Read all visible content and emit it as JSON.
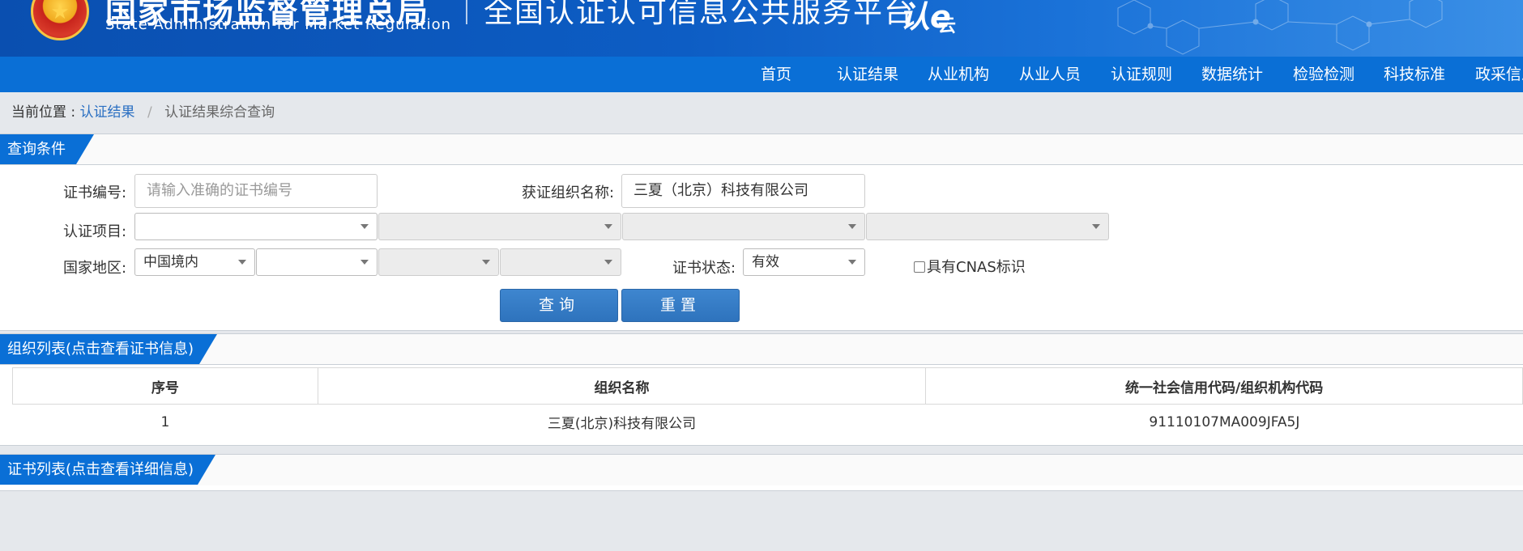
{
  "header": {
    "agency_cn": "国家市场监督管理总局",
    "agency_en": "State Administration  for  Market Regulation",
    "platform_title": "全国认证认可信息公共服务平台",
    "logo_text": "认e",
    "logo_sub": "云"
  },
  "nav": {
    "items": [
      "首页",
      "认证结果",
      "从业机构",
      "从业人员",
      "认证规则",
      "数据统计",
      "检验检测",
      "科技标准",
      "政采信息"
    ]
  },
  "breadcrumb": {
    "prefix": "当前位置 :",
    "link": "认证结果",
    "separator": "/",
    "current": "认证结果综合查询"
  },
  "query_panel": {
    "title": "查询条件",
    "cert_no_label": "证书编号:",
    "cert_no_placeholder": "请输入准确的证书编号",
    "org_name_label": "获证组织名称:",
    "org_name_value": "三夏（北京）科技有限公司",
    "cert_item_label": "认证项目:",
    "region_label": "国家地区:",
    "region_value": "中国境内",
    "status_label": "证书状态:",
    "status_value": "有效",
    "cnas_label": "具有CNAS标识",
    "search_button": "查询",
    "reset_button": "重置"
  },
  "org_list": {
    "title": "组织列表(点击查看证书信息)",
    "columns": [
      "序号",
      "组织名称",
      "统一社会信用代码/组织机构代码"
    ],
    "rows": [
      [
        "1",
        "三夏(北京)科技有限公司",
        "91110107MA009JFA5J"
      ]
    ]
  },
  "cert_list": {
    "title": "证书列表(点击查看详细信息)"
  },
  "colors": {
    "header_blue": "#0a4fb0",
    "nav_blue": "#0a6fd6",
    "button_blue": "#2e73bd",
    "link_blue": "#2a6fc2"
  }
}
